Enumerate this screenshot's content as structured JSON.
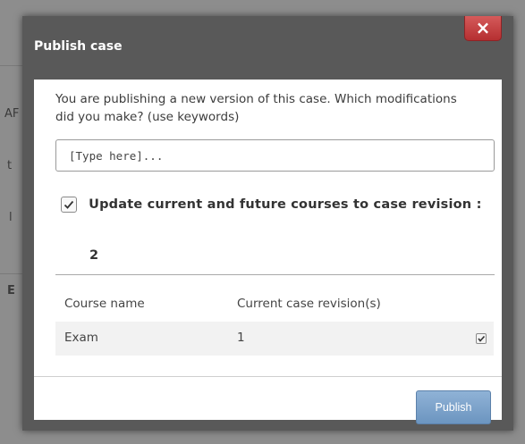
{
  "background": {
    "fragments": [
      "AF",
      "t",
      "l",
      "E"
    ]
  },
  "dialog": {
    "title": "Publish case",
    "close_label": "×",
    "intro_text": "You are publishing a new version of this case. Which modifications did you make? (use keywords)",
    "keywords_input": {
      "placeholder": "[Type here]...",
      "value": ""
    },
    "update_checkbox": {
      "checked": true,
      "label": "Update current and future courses to case revision :"
    },
    "revision_number": "2",
    "courses_table": {
      "headers": [
        "Course name",
        "Current case revision(s)"
      ],
      "rows": [
        {
          "course_name": "Exam",
          "revision": "1",
          "checked": true
        }
      ]
    },
    "publish_label": "Publish"
  },
  "colors": {
    "overlay": "#8d8d8d",
    "dialog_frame": "#595959",
    "close_button": "#c9443f",
    "publish_button": "#7ba3cc"
  }
}
